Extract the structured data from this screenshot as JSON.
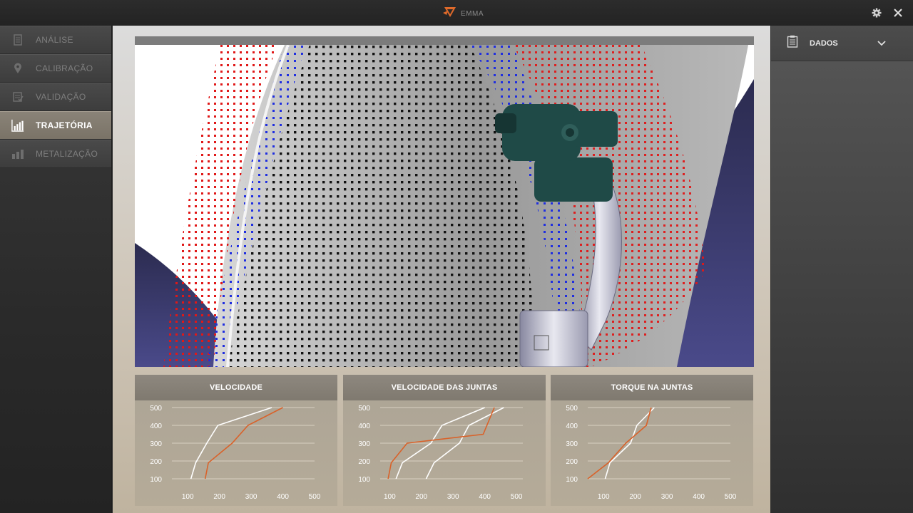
{
  "app": {
    "logo_text": "EMMA"
  },
  "topbar": {
    "settings_icon": "gear-icon",
    "close_icon": "close-icon"
  },
  "sidebar": {
    "items": [
      {
        "label": "ANÁLISE",
        "icon": "document-icon",
        "active": false
      },
      {
        "label": "CALIBRAÇÃO",
        "icon": "map-pin-icon",
        "active": false
      },
      {
        "label": "VALIDAÇÃO",
        "icon": "checklist-icon",
        "active": false
      },
      {
        "label": "TRAJETÓRIA",
        "icon": "bar-chart-icon",
        "active": true
      },
      {
        "label": "METALIZAÇÃO",
        "icon": "factory-icon",
        "active": false
      }
    ]
  },
  "right_panel": {
    "title": "DADOS",
    "icon": "clipboard-icon",
    "toggle_icon": "chevron-down-icon"
  },
  "colors": {
    "accent": "#e06a2a",
    "white_series": "#ffffff",
    "orange_series": "#d9622a"
  },
  "charts": [
    {
      "title": "VELOCIDADE"
    },
    {
      "title": "VELOCIDADE DAS JUNTAS"
    },
    {
      "title": "TORQUE NA JUNTAS"
    }
  ],
  "chart_data": [
    {
      "type": "line",
      "title": "VELOCIDADE",
      "xticks": [
        "100",
        "200",
        "300",
        "400",
        "500"
      ],
      "yticks": [
        "500",
        "400",
        "300",
        "200",
        "100"
      ],
      "xlim": [
        50,
        500
      ],
      "ylim": [
        100,
        500
      ],
      "grid": true,
      "series": [
        {
          "color": "white",
          "points": [
            [
              110,
              100
            ],
            [
              125,
              190
            ],
            [
              160,
              300
            ],
            [
              195,
              400
            ],
            [
              365,
              500
            ]
          ]
        },
        {
          "color": "orange",
          "points": [
            [
              155,
              100
            ],
            [
              165,
              190
            ],
            [
              240,
              300
            ],
            [
              290,
              400
            ],
            [
              400,
              500
            ]
          ]
        }
      ]
    },
    {
      "type": "line",
      "title": "VELOCIDADE DAS JUNTAS",
      "xticks": [
        "100",
        "200",
        "300",
        "400",
        "500"
      ],
      "yticks": [
        "500",
        "400",
        "300",
        "200",
        "100"
      ],
      "xlim": [
        70,
        520
      ],
      "ylim": [
        100,
        500
      ],
      "grid": true,
      "series": [
        {
          "color": "white",
          "points": [
            [
              120,
              100
            ],
            [
              140,
              190
            ],
            [
              230,
              300
            ],
            [
              265,
              400
            ],
            [
              400,
              500
            ]
          ]
        },
        {
          "color": "white",
          "points": [
            [
              215,
              100
            ],
            [
              240,
              190
            ],
            [
              320,
              300
            ],
            [
              350,
              400
            ],
            [
              460,
              500
            ]
          ]
        },
        {
          "color": "orange",
          "points": [
            [
              95,
              100
            ],
            [
              105,
              190
            ],
            [
              155,
              300
            ],
            [
              395,
              350
            ],
            [
              430,
              500
            ]
          ]
        }
      ]
    },
    {
      "type": "line",
      "title": "TORQUE NA JUNTAS",
      "xticks": [
        "100",
        "200",
        "300",
        "400",
        "500"
      ],
      "yticks": [
        "500",
        "400",
        "300",
        "200",
        "100"
      ],
      "xlim": [
        50,
        500
      ],
      "ylim": [
        100,
        500
      ],
      "grid": true,
      "series": [
        {
          "color": "white",
          "points": [
            [
              105,
              100
            ],
            [
              120,
              190
            ],
            [
              185,
              300
            ],
            [
              205,
              400
            ],
            [
              260,
              500
            ]
          ]
        },
        {
          "color": "orange",
          "points": [
            [
              50,
              100
            ],
            [
              115,
              190
            ],
            [
              170,
              300
            ],
            [
              235,
              400
            ],
            [
              250,
              500
            ]
          ]
        }
      ]
    }
  ]
}
